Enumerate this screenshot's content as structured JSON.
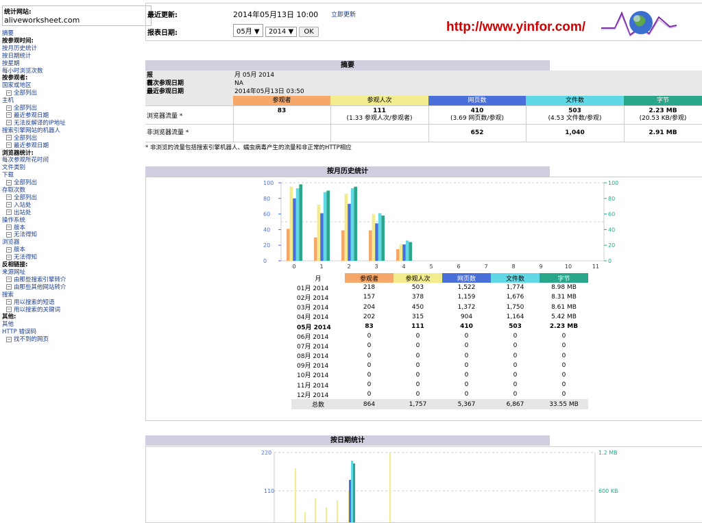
{
  "sidebar": {
    "site_label": "统计网站:",
    "site_value": "aliveworksheet.com",
    "items": [
      {
        "text": "摘要",
        "type": "link"
      },
      {
        "text": "按参观时间:",
        "type": "head"
      },
      {
        "text": "按月历史统计",
        "type": "link"
      },
      {
        "text": "按日期统计",
        "type": "link"
      },
      {
        "text": "按星期",
        "type": "link"
      },
      {
        "text": "每小时浏览次数",
        "type": "link"
      },
      {
        "text": "按参观者:",
        "type": "head"
      },
      {
        "text": "国家或地区",
        "type": "link"
      },
      {
        "text": "全部列出",
        "type": "sub"
      },
      {
        "text": "主机",
        "type": "link"
      },
      {
        "text": "全部列出",
        "type": "sub"
      },
      {
        "text": "最近参观日期",
        "type": "sub"
      },
      {
        "text": "无法反解译的IP地址",
        "type": "sub"
      },
      {
        "text": "搜索引擎网站的机器人",
        "type": "link"
      },
      {
        "text": "全部列出",
        "type": "sub"
      },
      {
        "text": "最近参观日期",
        "type": "sub"
      },
      {
        "text": "浏览器统计:",
        "type": "head"
      },
      {
        "text": "每次参观所花时间",
        "type": "link"
      },
      {
        "text": "文件类别",
        "type": "link"
      },
      {
        "text": "下载",
        "type": "link"
      },
      {
        "text": "全部列出",
        "type": "sub"
      },
      {
        "text": "存取次数",
        "type": "link"
      },
      {
        "text": "全部列出",
        "type": "sub"
      },
      {
        "text": "入站处",
        "type": "sub"
      },
      {
        "text": "出站处",
        "type": "sub"
      },
      {
        "text": "操作系统",
        "type": "link"
      },
      {
        "text": "版本",
        "type": "sub"
      },
      {
        "text": "无法得知",
        "type": "sub"
      },
      {
        "text": "浏览器",
        "type": "link"
      },
      {
        "text": "版本",
        "type": "sub"
      },
      {
        "text": "无法得知",
        "type": "sub"
      },
      {
        "text": "反相链接:",
        "type": "head"
      },
      {
        "text": "来源网址",
        "type": "link"
      },
      {
        "text": "由那些搜索引擎转介",
        "type": "sub"
      },
      {
        "text": "由那些其他网站转介",
        "type": "sub"
      },
      {
        "text": "搜索",
        "type": "link"
      },
      {
        "text": "用以搜索的短语",
        "type": "sub"
      },
      {
        "text": "用以搜索的关键词",
        "type": "sub"
      },
      {
        "text": "其他:",
        "type": "head"
      },
      {
        "text": "其他",
        "type": "link"
      },
      {
        "text": "HTTP 错误码",
        "type": "link"
      },
      {
        "text": "找不到的网页",
        "type": "sub"
      }
    ]
  },
  "top": {
    "last_update_label": "最近更新:",
    "last_update_value": "2014年05月13日 10:00",
    "update_now": "立即更新",
    "report_date_label": "报表日期:",
    "month_select": "05月",
    "year_select": "2014",
    "ok_button": "OK",
    "brand_url": "http://www.yinfor.com/"
  },
  "summary": {
    "title": "摘要",
    "rows": [
      {
        "label": "报表日期",
        "value": "月 05月 2014"
      },
      {
        "label": "首次参观日期",
        "value": "NA"
      },
      {
        "label": "最近参观日期",
        "value": "2014年05月13日 03:50"
      }
    ],
    "headers": [
      "参观者",
      "参观人次",
      "网页数",
      "文件数",
      "字节"
    ],
    "header_colors": [
      "#f6a86b",
      "#f2ec8f",
      "#4a6fd8",
      "#60d8e6",
      "#2aa68a"
    ],
    "viewed_label": "浏览器流量 *",
    "viewed": [
      {
        "main": "83",
        "sub": ""
      },
      {
        "main": "111",
        "sub": "(1.33 参观人次/参观者)"
      },
      {
        "main": "410",
        "sub": "(3.69 网页数/参观)"
      },
      {
        "main": "503",
        "sub": "(4.53 文件数/参观)"
      },
      {
        "main": "2.23 MB",
        "sub": "(20.53 KB/参观)"
      }
    ],
    "notviewed_label": "非浏览器流量 *",
    "notviewed": [
      "",
      "",
      "652",
      "1,040",
      "2.91 MB"
    ],
    "footnote": "* 非浏览的流量包括搜索引擎机器人、蠕虫病毒产生的流量和非正常的HTTP相应"
  },
  "monthly": {
    "title": "按月历史统计",
    "headers": [
      "月",
      "参观者",
      "参观人次",
      "网页数",
      "文件数",
      "字节"
    ],
    "rows": [
      [
        "01月 2014",
        "218",
        "503",
        "1,522",
        "1,774",
        "8.98 MB"
      ],
      [
        "02月 2014",
        "157",
        "378",
        "1,159",
        "1,676",
        "8.31 MB"
      ],
      [
        "03月 2014",
        "204",
        "450",
        "1,372",
        "1,750",
        "8.61 MB"
      ],
      [
        "04月 2014",
        "202",
        "315",
        "904",
        "1,164",
        "5.42 MB"
      ],
      [
        "05月 2014",
        "83",
        "111",
        "410",
        "503",
        "2.23 MB"
      ],
      [
        "06月 2014",
        "0",
        "0",
        "0",
        "0",
        "0"
      ],
      [
        "07月 2014",
        "0",
        "0",
        "0",
        "0",
        "0"
      ],
      [
        "08月 2014",
        "0",
        "0",
        "0",
        "0",
        "0"
      ],
      [
        "09月 2014",
        "0",
        "0",
        "0",
        "0",
        "0"
      ],
      [
        "10月 2014",
        "0",
        "0",
        "0",
        "0",
        "0"
      ],
      [
        "11月 2014",
        "0",
        "0",
        "0",
        "0",
        "0"
      ],
      [
        "12月 2014",
        "0",
        "0",
        "0",
        "0",
        "0"
      ]
    ],
    "total": [
      "总数",
      "864",
      "1,757",
      "5,367",
      "6,867",
      "33.55 MB"
    ]
  },
  "daily": {
    "title": "按日期统计",
    "left_ticks": [
      "220",
      "110"
    ],
    "right_ticks": [
      "1.2 MB",
      "600 KB"
    ]
  },
  "chart_data": [
    {
      "type": "bar",
      "x": [
        0,
        1,
        2,
        3,
        4,
        5,
        6,
        7,
        8,
        9,
        10,
        11
      ],
      "yticks_left": [
        0,
        20,
        40,
        60,
        80,
        100
      ],
      "yticks_right": [
        0,
        20,
        40,
        60,
        80,
        100
      ],
      "ylim": [
        0,
        100
      ],
      "series": [
        {
          "name": "参观者",
          "color": "#f6a86b",
          "values": [
            41,
            30,
            39,
            39,
            15,
            0,
            0,
            0,
            0,
            0,
            0,
            0
          ]
        },
        {
          "name": "参观人次",
          "color": "#f2ec8f",
          "values": [
            95,
            72,
            86,
            60,
            21,
            0,
            0,
            0,
            0,
            0,
            0,
            0
          ]
        },
        {
          "name": "网页数",
          "color": "#4a6fd8",
          "values": [
            80,
            61,
            73,
            48,
            21,
            0,
            0,
            0,
            0,
            0,
            0,
            0
          ]
        },
        {
          "name": "文件数",
          "color": "#60d8e6",
          "values": [
            93,
            88,
            93,
            61,
            26,
            0,
            0,
            0,
            0,
            0,
            0,
            0
          ]
        },
        {
          "name": "字节",
          "color": "#2aa68a",
          "values": [
            98,
            90,
            95,
            58,
            24,
            0,
            0,
            0,
            0,
            0,
            0,
            0
          ]
        }
      ]
    }
  ]
}
